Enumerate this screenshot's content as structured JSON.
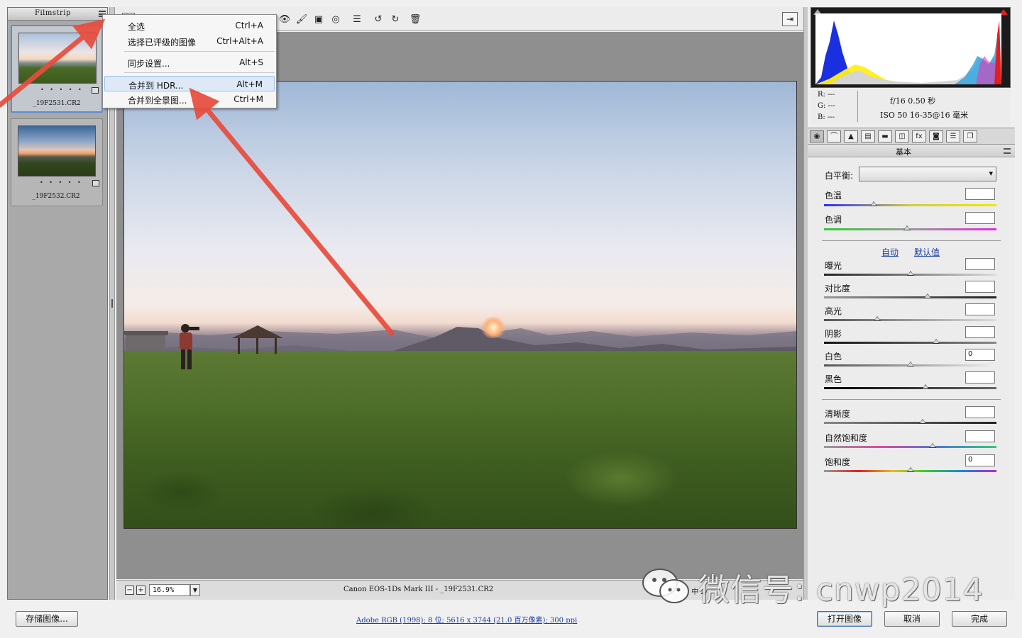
{
  "filmstrip": {
    "title": "Filmstrip",
    "items": [
      {
        "name": "_19F2531.CR2",
        "rating": "• • • • •",
        "selected": true
      },
      {
        "name": "_19F2532.CR2",
        "rating": "• • • • •",
        "selected": false
      }
    ]
  },
  "context_menu": {
    "items": [
      {
        "label": "全选",
        "shortcut": "Ctrl+A"
      },
      {
        "label": "选择已评级的图像",
        "shortcut": "Ctrl+Alt+A"
      },
      {
        "label": "同步设置...",
        "shortcut": "Alt+S"
      },
      {
        "label": "合并到 HDR...",
        "shortcut": "Alt+M"
      },
      {
        "label": "合并到全景图...",
        "shortcut": "Ctrl+M"
      }
    ]
  },
  "toolbar": {
    "icons": [
      "zoom-icon",
      "hand-icon",
      "white-balance-icon",
      "color-sampler-icon",
      "target-adjust-icon",
      "crop-icon",
      "straighten-icon",
      "spot-removal-icon",
      "red-eye-icon",
      "adjustment-brush-icon",
      "graduated-filter-icon",
      "radial-filter-icon",
      "preferences-icon",
      "rotate-left-icon",
      "rotate-right-icon",
      "trash-icon"
    ]
  },
  "statusbar": {
    "zoom": "16.9%",
    "camera": "Canon EOS-1Ds Mark III -  _19F2531.CR2",
    "right_text": "中 2/"
  },
  "histogram": {
    "r": "R:  ---",
    "g": "G:  ---",
    "b": "B:  ---",
    "exif_line1": "f/16   0.50 秒",
    "exif_line2": "ISO 50   16-35@16 毫米"
  },
  "panel": {
    "title": "基本",
    "white_balance_label": "白平衡:",
    "white_balance_value": "",
    "auto_link": "自动",
    "default_link": "默认值",
    "sliders": [
      {
        "label": "色温",
        "value": "",
        "position": 0.29
      },
      {
        "label": "色调",
        "value": "",
        "position": 0.48
      },
      {
        "label": "曝光",
        "value": "",
        "position": 0.5
      },
      {
        "label": "对比度",
        "value": "",
        "position": 0.6
      },
      {
        "label": "高光",
        "value": "",
        "position": 0.31
      },
      {
        "label": "阴影",
        "value": "",
        "position": 0.65
      },
      {
        "label": "白色",
        "value": "0",
        "position": 0.5
      },
      {
        "label": "黑色",
        "value": "",
        "position": 0.59
      },
      {
        "label": "清晰度",
        "value": "",
        "position": 0.57
      },
      {
        "label": "自然饱和度",
        "value": "",
        "position": 0.63
      },
      {
        "label": "饱和度",
        "value": "0",
        "position": 0.5
      }
    ]
  },
  "bottom": {
    "save_label": "存储图像...",
    "workflow_link": "Adobe RGB (1998); 8 位; 5616 x 3744 (21.0 百万像素); 300 ppi",
    "open_label": "打开图像",
    "cancel_label": "取消",
    "done_label": "完成"
  },
  "watermark": {
    "text": "微信号: cnwp2014"
  },
  "colors": {
    "accent": "#3a6fb5",
    "annotation_arrow": "#e84c3d",
    "link": "#1a3ea8"
  }
}
